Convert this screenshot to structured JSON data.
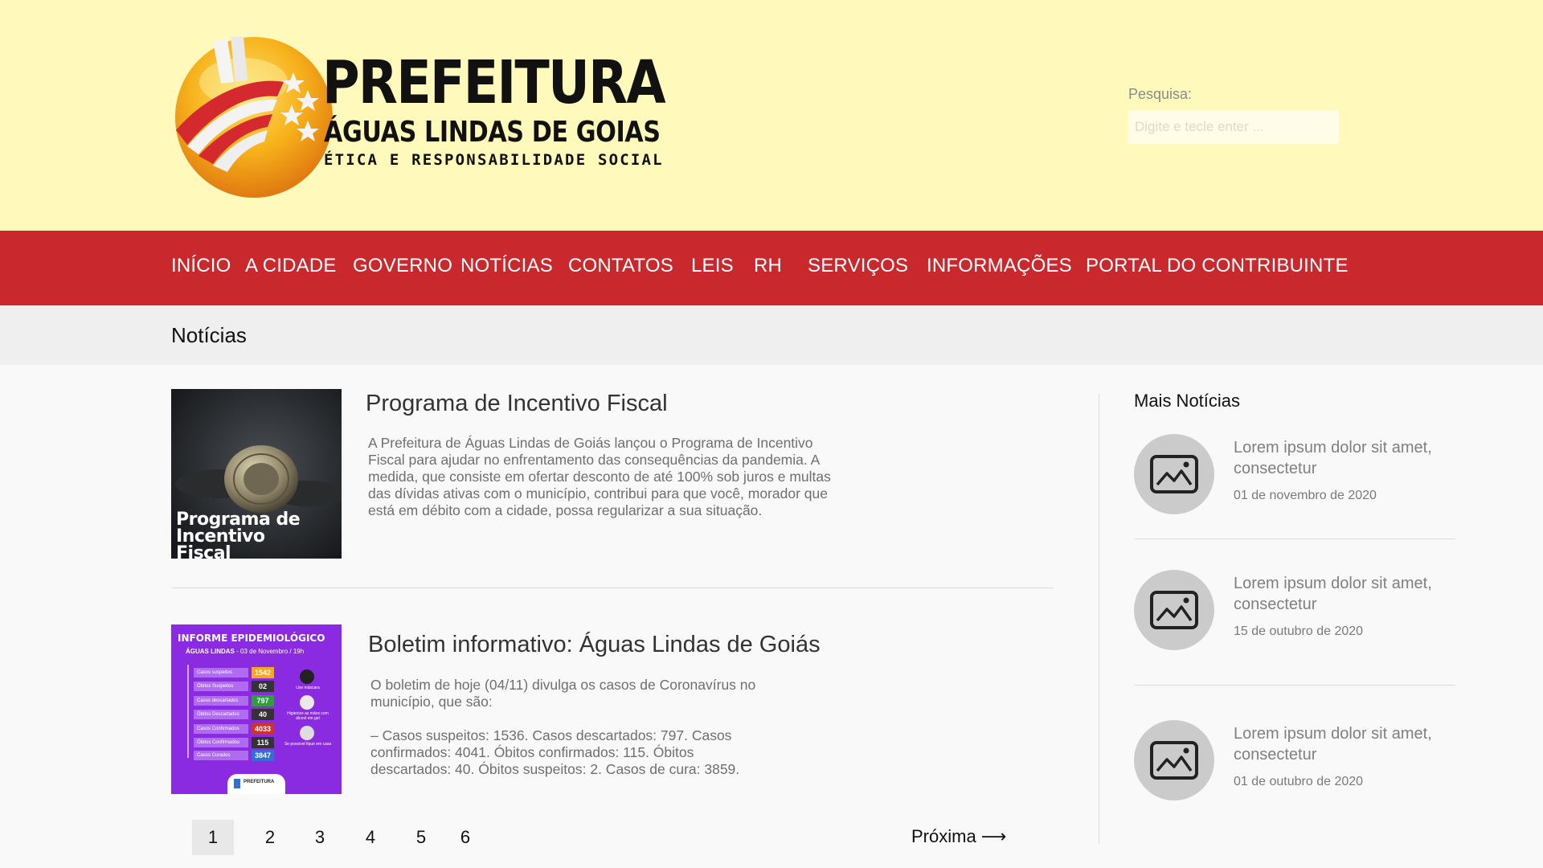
{
  "header": {
    "logo": {
      "title": "PREFEITURA",
      "subtitle": "ÁGUAS LINDAS DE GOIAS",
      "tagline": "ÉTICA E RESPONSABILIDADE SOCIAL"
    },
    "search": {
      "label": "Pesquisa:",
      "placeholder": "Digite e tecle enter ..."
    }
  },
  "nav": {
    "items": [
      {
        "label": "INÍCIO"
      },
      {
        "label": "A CIDADE"
      },
      {
        "label": "GOVERNO"
      },
      {
        "label": "NOTÍCIAS"
      },
      {
        "label": "CONTATOS"
      },
      {
        "label": "LEIS"
      },
      {
        "label": "RH"
      },
      {
        "label": "SERVIÇOS"
      },
      {
        "label": "INFORMAÇÕES"
      },
      {
        "label": "PORTAL DO CONTRIBUINTE"
      }
    ]
  },
  "page": {
    "title": "Notícias"
  },
  "articles": [
    {
      "title": "Programa de Incentivo Fiscal",
      "excerpt": "A Prefeitura de Águas Lindas de Goiás lançou o Programa de Incentivo Fiscal para ajudar no enfrentamento das consequências da pandemia. A medida, que consiste em ofertar desconto de até 100% sob juros e multas das dívidas ativas com o município, contribui para que você, morador que está em débito com a cidade, possa regularizar a sua situação.",
      "image_caption": "Programa de Incentivo Fiscal"
    },
    {
      "title": "Boletim informativo: Águas Lindas de Goiás",
      "excerpt": "O boletim de hoje (04/11) divulga os casos de Coronavírus no município, que são:",
      "excerpt2": "–  Casos suspeitos: 1536. Casos descartados: 797. Casos confirmados: 4041. Óbitos confirmados: 115. Óbitos descartados: 40. Óbitos suspeitos: 2. Casos de cura: 3859.",
      "image": {
        "heading": "INFORME EPIDEMIOLÓGICO",
        "subheading": "ÁGUAS LINDAS",
        "date": "- 03 de Novembro / 19h",
        "rows": [
          {
            "label": "Casos suspeitos",
            "value": "1542",
            "color": "#f5a623"
          },
          {
            "label": "Óbitos Suspeitos",
            "value": "02",
            "color": "#333333"
          },
          {
            "label": "Casos descartados",
            "value": "797",
            "color": "#2e9e3f"
          },
          {
            "label": "Óbitos Descartados",
            "value": "40",
            "color": "#333333"
          },
          {
            "label": "Casos Confirmados",
            "value": "4033",
            "color": "#d0312d"
          },
          {
            "label": "Óbitos Confirmados",
            "value": "115",
            "color": "#333333"
          },
          {
            "label": "Casos Curados",
            "value": "3847",
            "color": "#2f6fd6"
          }
        ],
        "tips": [
          "Use máscara",
          "Higienize as mãos com álcool em gel",
          "Se possível fique em casa"
        ],
        "footer": "PREFEITURA"
      }
    }
  ],
  "pagination": {
    "pages": [
      "1",
      "2",
      "3",
      "4",
      "5",
      "6"
    ],
    "active": "1",
    "next_label": "Próxima ⟶"
  },
  "sidebar": {
    "title": "Mais Notícias",
    "items": [
      {
        "text": "Lorem ipsum dolor sit amet, consectetur",
        "date": "01 de novembro de 2020",
        "icon": "image-placeholder-icon"
      },
      {
        "text": "Lorem ipsum dolor sit amet, consectetur",
        "date": "15 de outubro de 2020",
        "icon": "image-placeholder-icon"
      },
      {
        "text": "Lorem ipsum dolor sit amet, consectetur",
        "date": "01 de outubro de 2020",
        "icon": "image-placeholder-icon"
      }
    ]
  },
  "colors": {
    "header_bg": "#fffabb",
    "nav_bg": "#c9282d",
    "band_bg": "#efefef",
    "page_bg": "#f9f9f9"
  }
}
